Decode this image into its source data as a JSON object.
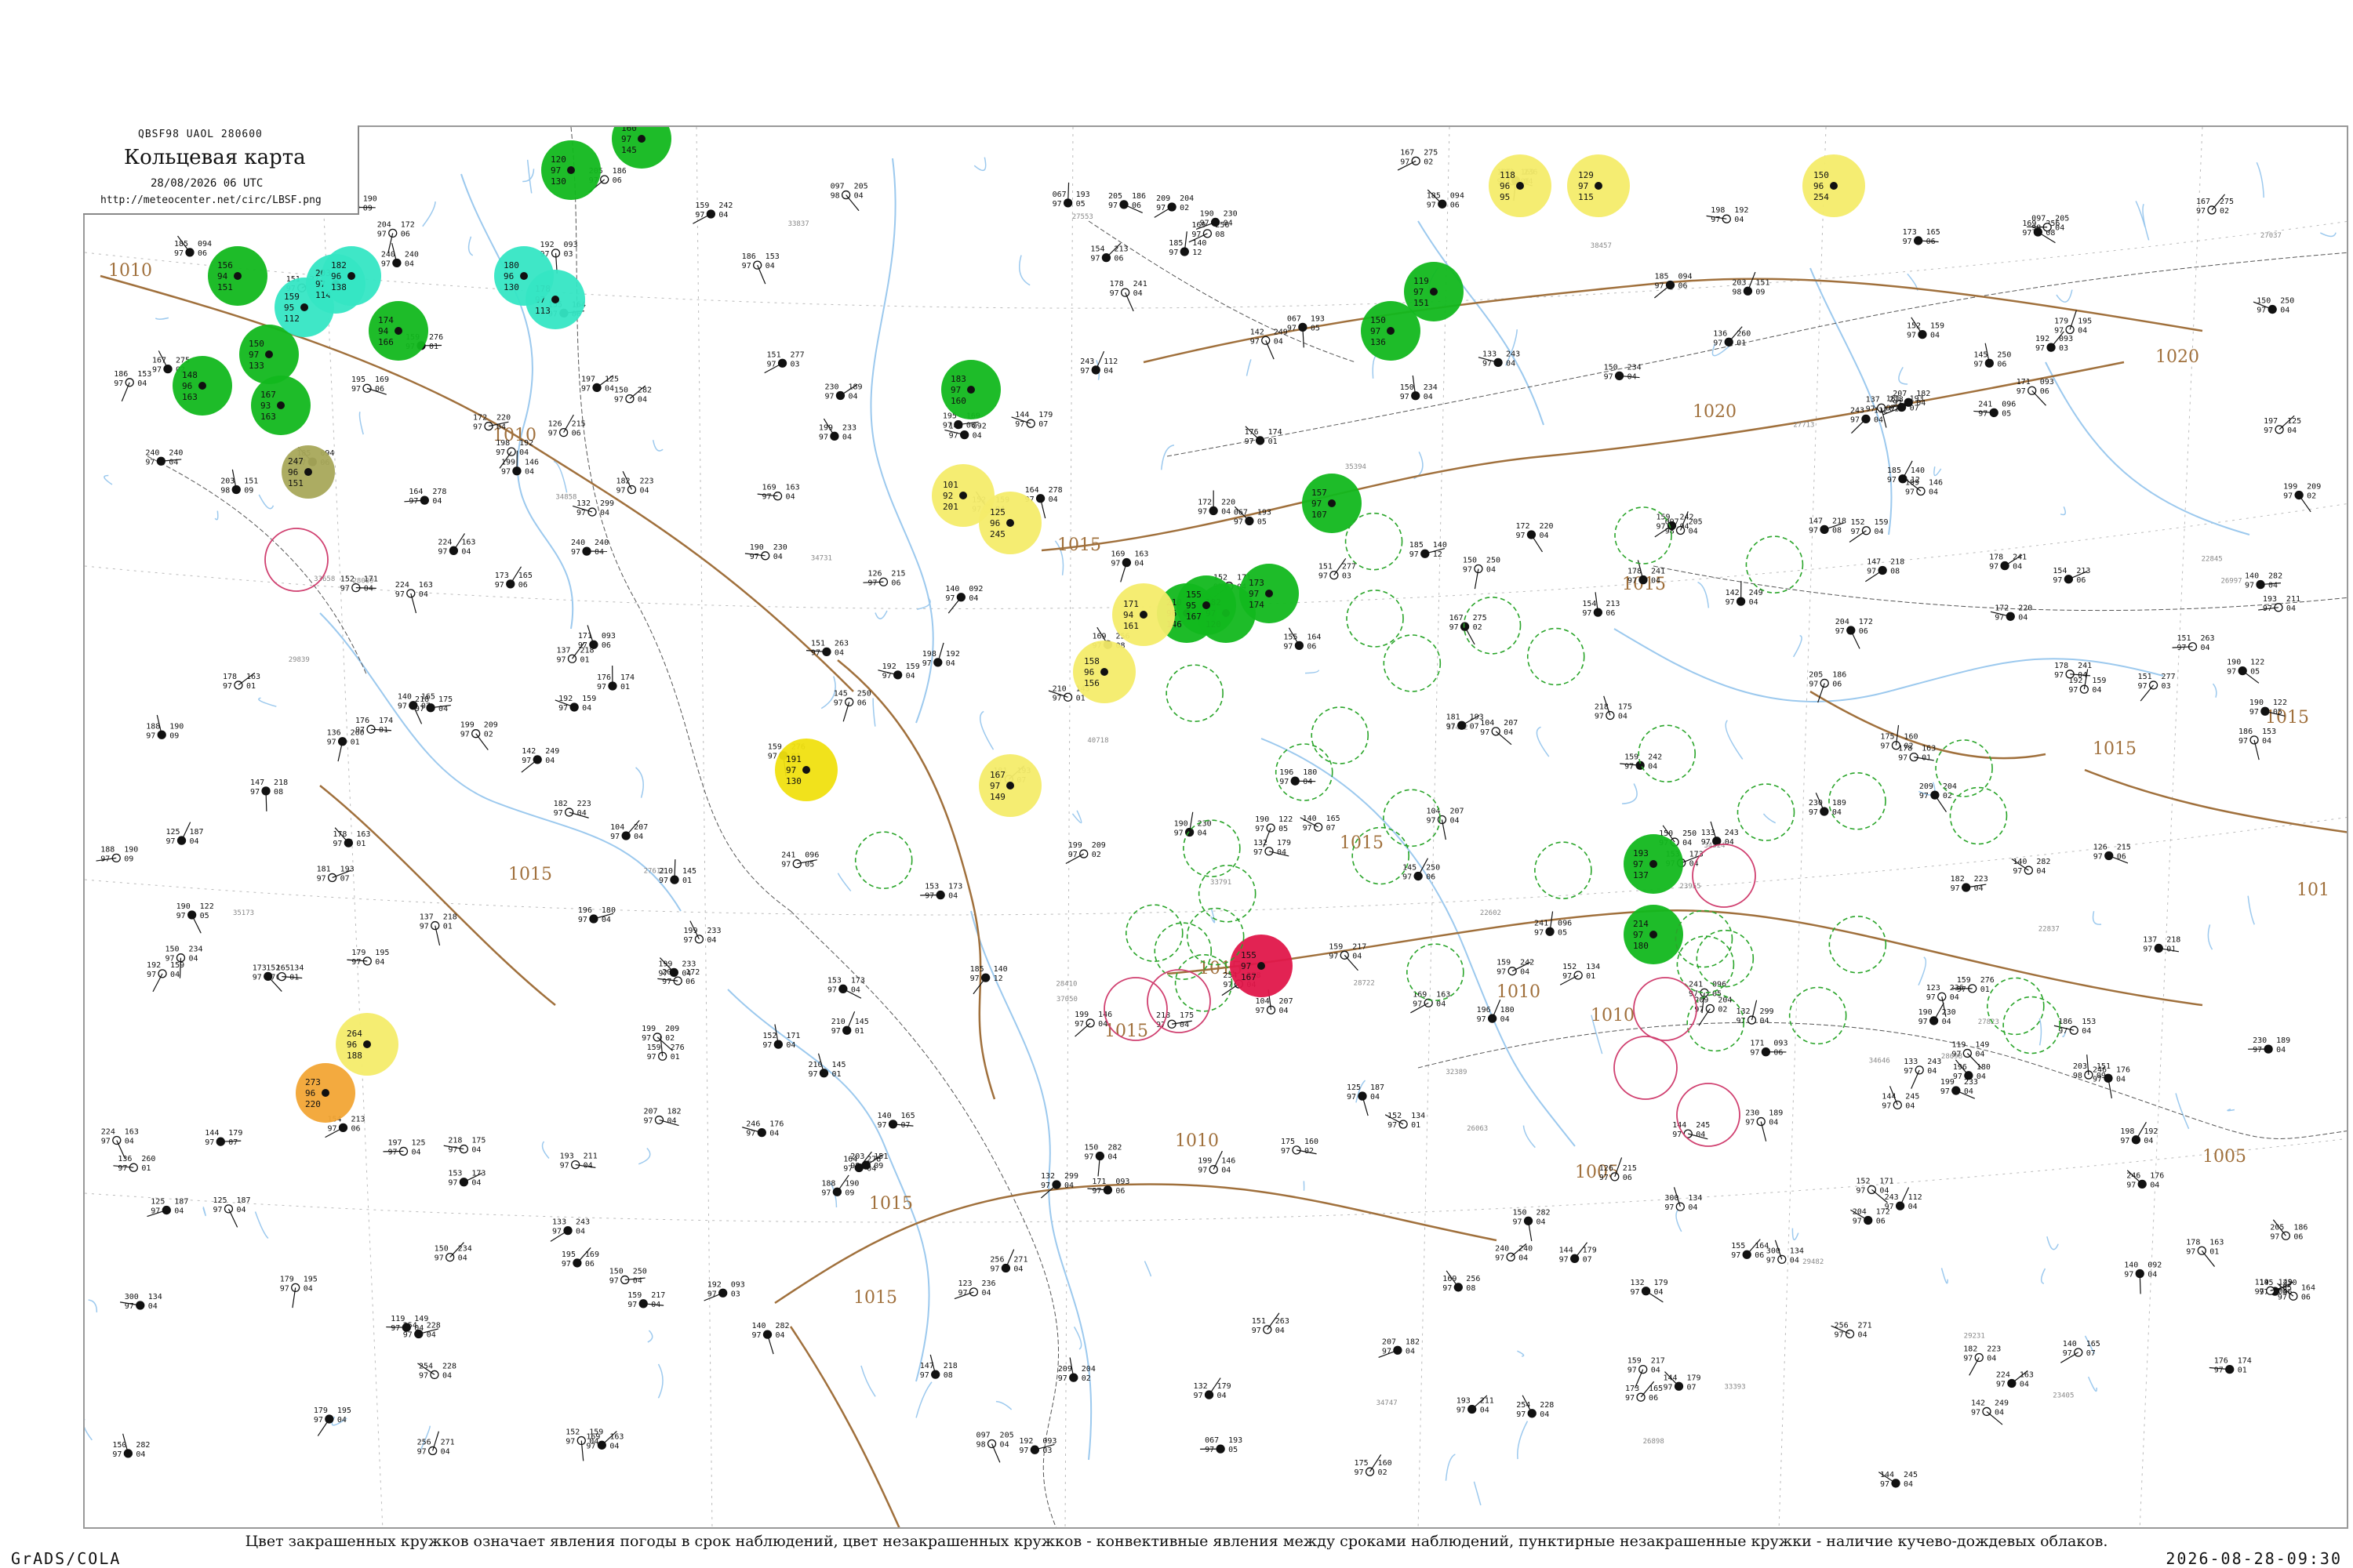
{
  "header": {
    "codes": "QBSF98  UAOL  280600",
    "title": "Кольцевая карта",
    "datetime": "28/08/2026 06 UTC",
    "url": "http://meteocenter.net/circ/LBSF.png"
  },
  "caption": "Цвет закрашенных кружков означает явления погоды в срок наблюдений, цвет незакрашенных кружков - конвективные явления между сроками наблюдений, пунктирные незакрашенные кружки - наличие кучево-дождевых облаков.",
  "footer": {
    "left": "GrADS/COLA",
    "right": "2026-08-28-09:30"
  },
  "colors": {
    "rain": "#12b81e",
    "shower_rain": "#35e6c4",
    "fog": "#f4ec6a",
    "storm": "#f0e010",
    "haze": "#a8a85a",
    "dust": "#f2a535",
    "thunder": "#e0174a",
    "isobar": "#a0703c",
    "river": "#9cc9ee",
    "border": "#555555",
    "cb_dashed": "#2aa52a",
    "thunder_ring": "#d04070"
  },
  "isobar_labels": [
    "1010",
    "1010",
    "1015",
    "1010",
    "1015",
    "1020",
    "1020",
    "1015",
    "1015",
    "1015",
    "1015",
    "1010",
    "1015",
    "1010",
    "1005",
    "1005",
    "1015",
    "1015",
    "1015",
    "101"
  ],
  "stations": [
    {
      "p": "094",
      "t": "185",
      "d": "97",
      "w": "06"
    },
    {
      "p": "172",
      "t": "204",
      "d": "97",
      "w": "06"
    },
    {
      "p": "093",
      "t": "192",
      "d": "97",
      "w": "03"
    },
    {
      "p": "205",
      "t": "097",
      "d": "98",
      "w": "04"
    },
    {
      "p": "193",
      "t": "067",
      "d": "97",
      "w": "05"
    },
    {
      "p": "140",
      "t": "185",
      "d": "97",
      "w": "12"
    },
    {
      "p": "169",
      "t": "195",
      "d": "97",
      "w": "06"
    },
    {
      "p": "192",
      "t": "198",
      "d": "97",
      "w": "04"
    },
    {
      "p": "165",
      "t": "173",
      "d": "97",
      "w": "06"
    },
    {
      "p": "256",
      "t": "169",
      "d": "97",
      "w": "08"
    },
    {
      "p": "275",
      "t": "167",
      "d": "97",
      "w": "02"
    },
    {
      "p": "276",
      "t": "159",
      "d": "97",
      "w": "01"
    },
    {
      "p": "282",
      "t": "150",
      "d": "97",
      "w": "04"
    },
    {
      "p": "277",
      "t": "151",
      "d": "97",
      "w": "03"
    },
    {
      "p": "179",
      "t": "144",
      "d": "97",
      "w": "07"
    },
    {
      "p": "249",
      "t": "142",
      "d": "97",
      "w": "04"
    },
    {
      "p": "243",
      "t": "133",
      "d": "97",
      "w": "04"
    },
    {
      "p": "234",
      "t": "150",
      "d": "97",
      "w": "04"
    },
    {
      "p": "218",
      "t": "137",
      "d": "97",
      "w": "01"
    },
    {
      "p": "093",
      "t": "171",
      "d": "97",
      "w": "06"
    },
    {
      "p": "151",
      "t": "203",
      "d": "98",
      "w": "09"
    },
    {
      "p": "163",
      "t": "224",
      "d": "97",
      "w": "04"
    },
    {
      "p": "240",
      "t": "240",
      "d": "97",
      "w": "04"
    },
    {
      "p": "163",
      "t": "169",
      "d": "97",
      "w": "04"
    },
    {
      "p": "159",
      "t": "152",
      "d": "97",
      "w": "04"
    },
    {
      "p": "220",
      "t": "172",
      "d": "97",
      "w": "04"
    },
    {
      "p": "250",
      "t": "150",
      "d": "97",
      "w": "04"
    },
    {
      "p": "242",
      "t": "159",
      "d": "97",
      "w": "04"
    },
    {
      "p": "218",
      "t": "147",
      "d": "97",
      "w": "08"
    },
    {
      "p": "213",
      "t": "154",
      "d": "97",
      "w": "06"
    },
    {
      "p": "190",
      "t": "188",
      "d": "97",
      "w": "09"
    },
    {
      "p": "165",
      "t": "140",
      "d": "97",
      "w": "07"
    },
    {
      "p": "174",
      "t": "176",
      "d": "97",
      "w": "01"
    },
    {
      "p": "250",
      "t": "145",
      "d": "97",
      "w": "06"
    },
    {
      "p": "145",
      "t": "210",
      "d": "97",
      "w": "01"
    },
    {
      "p": "164",
      "t": "155",
      "d": "97",
      "w": "06"
    },
    {
      "p": "193",
      "t": "181",
      "d": "97",
      "w": "07"
    },
    {
      "p": "175",
      "t": "218",
      "d": "97",
      "w": "04"
    },
    {
      "p": "186",
      "t": "205",
      "d": "97",
      "w": "06"
    },
    {
      "p": "241",
      "t": "178",
      "d": "97",
      "w": "04"
    },
    {
      "p": "187",
      "t": "125",
      "d": "97",
      "w": "04"
    },
    {
      "p": "163",
      "t": "178",
      "d": "97",
      "w": "01"
    },
    {
      "p": "223",
      "t": "182",
      "d": "97",
      "w": "04"
    },
    {
      "p": "096",
      "t": "241",
      "d": "97",
      "w": "05"
    },
    {
      "p": "209",
      "t": "199",
      "d": "97",
      "w": "02"
    },
    {
      "p": "122",
      "t": "190",
      "d": "97",
      "w": "05"
    },
    {
      "p": "207",
      "t": "104",
      "d": "97",
      "w": "04"
    },
    {
      "p": "173",
      "t": "153",
      "d": "97",
      "w": "04"
    },
    {
      "p": "189",
      "t": "230",
      "d": "97",
      "w": "04"
    },
    {
      "p": "215",
      "t": "126",
      "d": "97",
      "w": "06"
    },
    {
      "p": "159",
      "t": "192",
      "d": "97",
      "w": "04"
    },
    {
      "p": "195",
      "t": "179",
      "d": "97",
      "w": "04"
    },
    {
      "p": "233",
      "t": "199",
      "d": "97",
      "w": "04"
    },
    {
      "p": "171",
      "t": "152",
      "d": "97",
      "w": "04"
    },
    {
      "p": "146",
      "t": "199",
      "d": "97",
      "w": "04"
    },
    {
      "p": "228",
      "t": "254",
      "d": "97",
      "w": "04"
    },
    {
      "p": "180",
      "t": "196",
      "d": "97",
      "w": "04"
    },
    {
      "p": "204",
      "t": "209",
      "d": "97",
      "w": "02"
    },
    {
      "p": "230",
      "t": "190",
      "d": "97",
      "w": "04"
    },
    {
      "p": "153",
      "t": "186",
      "d": "97",
      "w": "04"
    },
    {
      "p": "260",
      "t": "136",
      "d": "97",
      "w": "01"
    },
    {
      "p": "125",
      "t": "197",
      "d": "97",
      "w": "04"
    },
    {
      "p": "211",
      "t": "193",
      "d": "97",
      "w": "04"
    },
    {
      "p": "278",
      "t": "164",
      "d": "97",
      "w": "04"
    },
    {
      "p": "299",
      "t": "132",
      "d": "97",
      "w": "04"
    },
    {
      "p": "160",
      "t": "175",
      "d": "97",
      "w": "02"
    },
    {
      "p": "134",
      "t": "152",
      "d": "97",
      "w": "01"
    },
    {
      "p": "245",
      "t": "144",
      "d": "97",
      "w": "04"
    },
    {
      "p": "112",
      "t": "243",
      "d": "97",
      "w": "04"
    },
    {
      "p": "176",
      "t": "246",
      "d": "97",
      "w": "04"
    },
    {
      "p": "134",
      "t": "300",
      "d": "97",
      "w": "04"
    },
    {
      "p": "149",
      "t": "119",
      "d": "97",
      "w": "04"
    },
    {
      "p": "217",
      "t": "159",
      "d": "97",
      "w": "04"
    },
    {
      "p": "282",
      "t": "140",
      "d": "97",
      "w": "04"
    },
    {
      "p": "236",
      "t": "123",
      "d": "97",
      "w": "04"
    },
    {
      "p": "263",
      "t": "151",
      "d": "97",
      "w": "04"
    },
    {
      "p": "182",
      "t": "207",
      "d": "97",
      "w": "04"
    },
    {
      "p": "179",
      "t": "132",
      "d": "97",
      "w": "04"
    },
    {
      "p": "271",
      "t": "256",
      "d": "97",
      "w": "04"
    },
    {
      "p": "092",
      "t": "140",
      "d": "97",
      "w": "04"
    }
  ],
  "weather_circles": [
    {
      "type": "rain",
      "top": "156",
      "left": "94",
      "bot": "151"
    },
    {
      "type": "rain",
      "top": "167",
      "left": "93",
      "bot": "163"
    },
    {
      "type": "rain",
      "top": "150",
      "left": "97",
      "bot": "133"
    },
    {
      "type": "rain",
      "top": "148",
      "left": "96",
      "bot": "163"
    },
    {
      "type": "rain",
      "top": "174",
      "left": "94",
      "bot": "166"
    },
    {
      "type": "rain",
      "top": "120",
      "left": "97",
      "bot": "130"
    },
    {
      "type": "rain",
      "top": "160",
      "left": "97",
      "bot": "145"
    },
    {
      "type": "rain",
      "top": "210",
      "left": "96",
      "bot": "146"
    },
    {
      "type": "rain",
      "top": "182",
      "left": "97",
      "bot": "120"
    },
    {
      "type": "rain",
      "top": "155",
      "left": "95",
      "bot": "167"
    },
    {
      "type": "rain",
      "top": "193",
      "left": "97",
      "bot": "137"
    },
    {
      "type": "rain",
      "top": "214",
      "left": "97",
      "bot": "180"
    },
    {
      "type": "rain",
      "top": "157",
      "left": "97",
      "bot": "107"
    },
    {
      "type": "rain",
      "top": "183",
      "left": "97",
      "bot": "160"
    },
    {
      "type": "rain",
      "top": "119",
      "left": "97",
      "bot": "151"
    },
    {
      "type": "rain",
      "top": "173",
      "left": "97",
      "bot": "174"
    },
    {
      "type": "rain",
      "top": "150",
      "left": "97",
      "bot": "136"
    },
    {
      "type": "shower_rain",
      "top": "159",
      "left": "95",
      "bot": "112"
    },
    {
      "type": "shower_rain",
      "top": "178",
      "left": "97",
      "bot": "113"
    },
    {
      "type": "shower_rain",
      "top": "203",
      "left": "97",
      "bot": "114"
    },
    {
      "type": "shower_rain",
      "top": "182",
      "left": "96",
      "bot": "138"
    },
    {
      "type": "shower_rain",
      "top": "180",
      "left": "96",
      "bot": "130"
    },
    {
      "type": "fog",
      "top": "118",
      "left": "96",
      "bot": "95"
    },
    {
      "type": "fog",
      "top": "129",
      "left": "97",
      "bot": "115"
    },
    {
      "type": "fog",
      "top": "150",
      "left": "96",
      "bot": "254"
    },
    {
      "type": "fog",
      "top": "101",
      "left": "92",
      "bot": "201"
    },
    {
      "type": "fog",
      "top": "125",
      "left": "96",
      "bot": "245"
    },
    {
      "type": "fog",
      "top": "158",
      "left": "96",
      "bot": "156"
    },
    {
      "type": "fog",
      "top": "171",
      "left": "94",
      "bot": "161"
    },
    {
      "type": "fog",
      "top": "167",
      "left": "97",
      "bot": "149"
    },
    {
      "type": "fog",
      "top": "264",
      "left": "96",
      "bot": "188"
    },
    {
      "type": "storm",
      "top": "191",
      "left": "97",
      "bot": "130"
    },
    {
      "type": "haze",
      "top": "247",
      "left": "96",
      "bot": "151"
    },
    {
      "type": "dust",
      "top": "273",
      "left": "96",
      "bot": "220"
    },
    {
      "type": "thunder",
      "top": "155",
      "left": "97",
      "bot": "167"
    }
  ],
  "station_ids": [
    "26063",
    "22837",
    "22845",
    "27037",
    "28009",
    "29231",
    "23955",
    "27612",
    "27713",
    "34646",
    "34747",
    "33837",
    "34524",
    "32389",
    "38457",
    "26898",
    "28698",
    "35394",
    "22602",
    "27553",
    "27823",
    "26997",
    "33393",
    "28722",
    "34858",
    "40718",
    "35173",
    "29482",
    "33658",
    "37472",
    "34731",
    "29839",
    "37050",
    "33791",
    "28410",
    "23405"
  ]
}
